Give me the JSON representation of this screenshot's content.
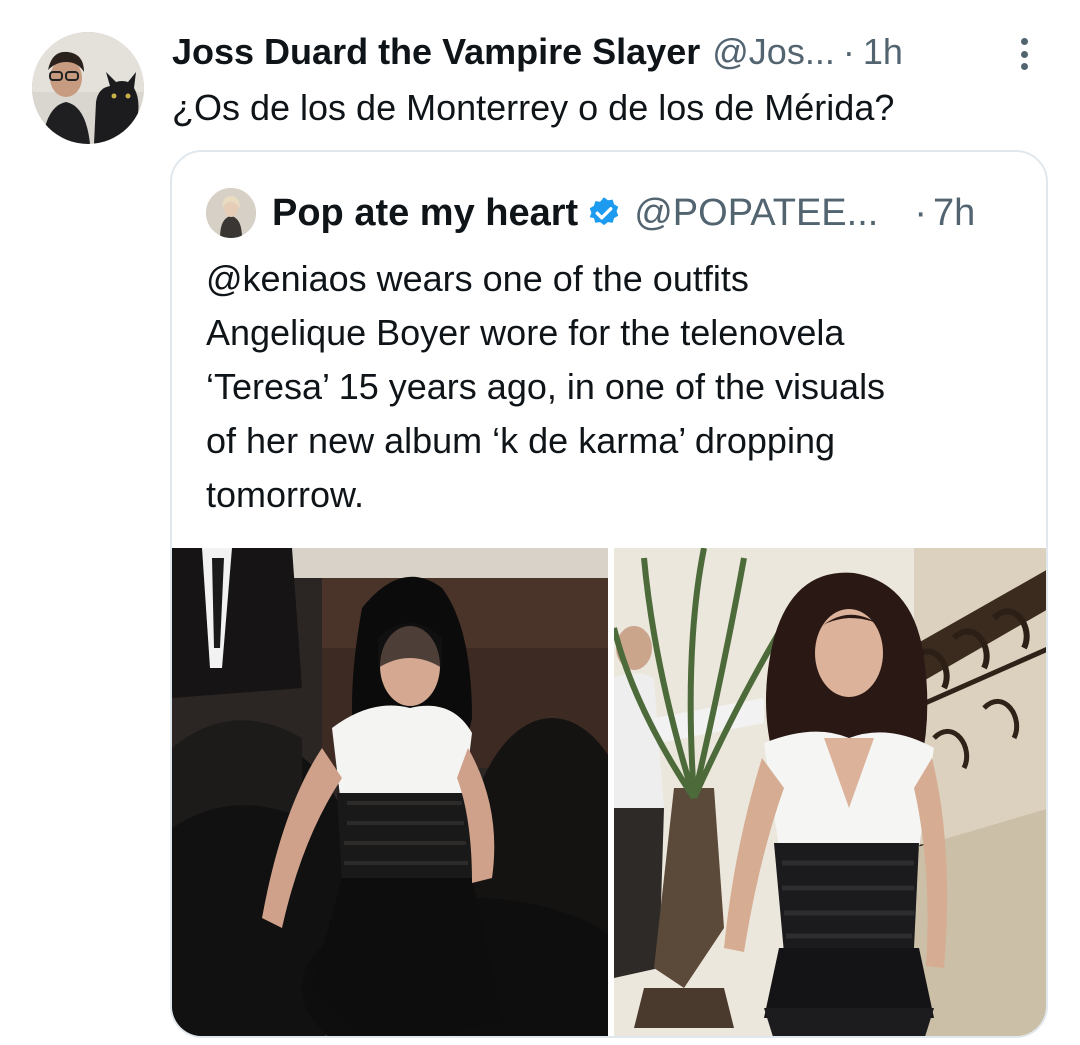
{
  "tweet": {
    "display_name": "Joss Duard the Vampire Slayer",
    "handle": "@Jos...",
    "separator": "·",
    "time": "1h",
    "text": "¿Os de los de Monterrey o de los de Mérida?",
    "more_icon": "more-vertical-icon"
  },
  "quote": {
    "display_name": "Pop ate my heart",
    "verified_icon": "verified-badge-icon",
    "handle": "@POPATEE...",
    "separator": "·",
    "time": "7h",
    "text_lines": [
      "@keniaos wears one of the outfits",
      "Angelique Boyer wore for the telenovela",
      "‘Teresa’ 15 years ago, in one of the visuals",
      "of her new album ‘k de karma’ dropping",
      "tomorrow."
    ]
  },
  "colors": {
    "text_primary": "#0f1419",
    "text_secondary": "#536471",
    "border": "#e1e8ed",
    "verified": "#1d9bf0"
  }
}
